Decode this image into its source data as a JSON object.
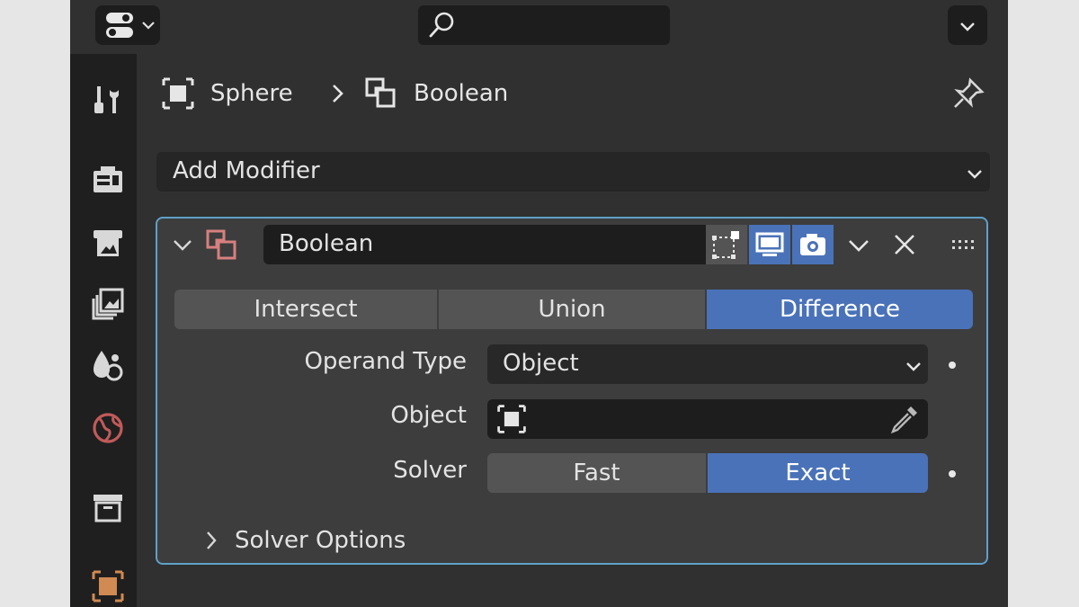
{
  "breadcrumb": {
    "object": "Sphere",
    "modifier": "Boolean"
  },
  "add_modifier_label": "Add Modifier",
  "modifier": {
    "name": "Boolean",
    "operations": [
      {
        "label": "Intersect",
        "active": false
      },
      {
        "label": "Union",
        "active": false
      },
      {
        "label": "Difference",
        "active": true
      }
    ],
    "operand_type_label": "Operand Type",
    "operand_type_value": "Object",
    "object_label": "Object",
    "object_value": "",
    "solver_label": "Solver",
    "solvers": [
      {
        "label": "Fast",
        "active": false
      },
      {
        "label": "Exact",
        "active": true
      }
    ],
    "solver_options_label": "Solver Options"
  },
  "colors": {
    "accent": "#4a72b8",
    "panel_outline": "#5fa0c8",
    "object_orange": "#d08a52"
  },
  "icons": {
    "sidebar": [
      "tool-icon",
      "render-icon",
      "output-icon",
      "view-layer-icon",
      "scene-icon",
      "world-icon",
      "collection-icon",
      "object-icon"
    ],
    "modifier_toggles": [
      "edit-mode-icon",
      "realtime-monitor-icon",
      "render-camera-icon"
    ]
  }
}
